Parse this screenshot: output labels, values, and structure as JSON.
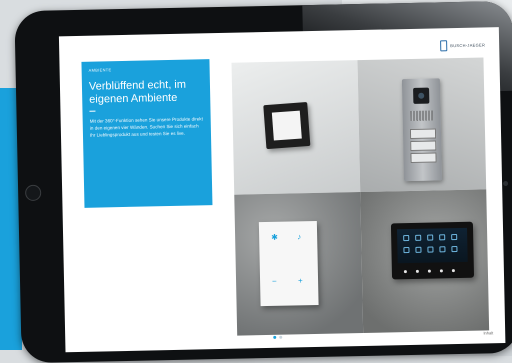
{
  "header": {
    "logo_text": "BUSCH-JAEGER"
  },
  "content": {
    "tag": "AMBIENTE",
    "title": "Verblüffend echt, im eigenen Ambiente",
    "body": "Mit der 360°-Funktion sehen Sie unsere Produkte direkt in den eigenen vier Wänden. Suchen Sie sich einfach Ihr Lieblingsprodukt aus und testen Sie es live.",
    "pager": {
      "total": 2,
      "active": 0
    },
    "corner_label": "Inhalt"
  },
  "images": [
    {
      "name": "light-switch-tile"
    },
    {
      "name": "door-intercom-tile"
    },
    {
      "name": "room-controller-tile"
    },
    {
      "name": "touch-panel-tile"
    }
  ],
  "colors": {
    "accent": "#1aa1dc",
    "bezel": "#0e1012"
  }
}
